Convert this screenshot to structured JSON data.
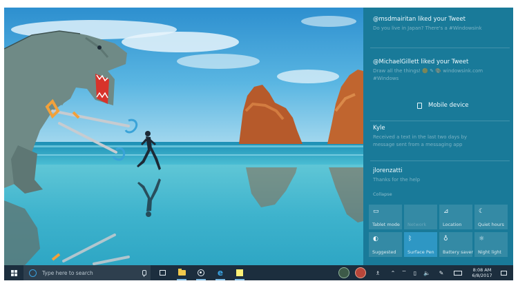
{
  "notifications": [
    {
      "title": "@msdmairitan liked your Tweet",
      "body": "Do you live in Japan? There's a #Windowsink"
    },
    {
      "title": "@MichaelGillett liked your Tweet",
      "body": "Draw all the things! 🟠 ✎ 🎨 windowsink.com",
      "body2": "#Windows"
    },
    {
      "title": "Kyle",
      "body": "Received a text in the last two days by",
      "body2": "message sent from a messaging app"
    },
    {
      "title": "jlorenzatti",
      "body": "Thanks for the help"
    }
  ],
  "mobile_device": {
    "label": "Mobile device"
  },
  "collapse_label": "Collapse",
  "quick_actions": [
    {
      "label": "Tablet mode",
      "icon": "tablet-icon",
      "icon_glyph": "▭",
      "active": false,
      "dim": false
    },
    {
      "label": "Network",
      "icon": "network-icon",
      "icon_glyph": "",
      "active": false,
      "dim": true
    },
    {
      "label": "Location",
      "icon": "location-icon",
      "icon_glyph": "⊿",
      "active": false,
      "dim": false
    },
    {
      "label": "Quiet hours",
      "icon": "moon-icon",
      "icon_glyph": "☾",
      "active": false,
      "dim": false
    },
    {
      "label": "Suggested",
      "icon": "suggested-icon",
      "icon_glyph": "◐",
      "active": false,
      "dim": false
    },
    {
      "label": "Surface Pen",
      "icon": "bluetooth-icon",
      "icon_glyph": "ᛒ",
      "active": true,
      "dim": false
    },
    {
      "label": "Battery saver",
      "icon": "battery-saver-icon",
      "icon_glyph": "♁",
      "active": false,
      "dim": false
    },
    {
      "label": "Night light",
      "icon": "night-light-icon",
      "icon_glyph": "☼",
      "active": false,
      "dim": false
    }
  ],
  "taskbar": {
    "search_placeholder": "Type here to search",
    "clock_time": "8:08 AM",
    "clock_date": "6/8/2017"
  },
  "tray": {
    "people_glyph": "♗",
    "chevron_glyph": "⌃",
    "network_glyph": "⌔",
    "battery_glyph": "▯",
    "volume_glyph": "🔈",
    "pen_glyph": "✎"
  },
  "colors": {
    "action_center": "#187696",
    "tile_active": "#2e97c4",
    "taskbar": "#1c2e3e",
    "accent": "#3aa2e0"
  }
}
